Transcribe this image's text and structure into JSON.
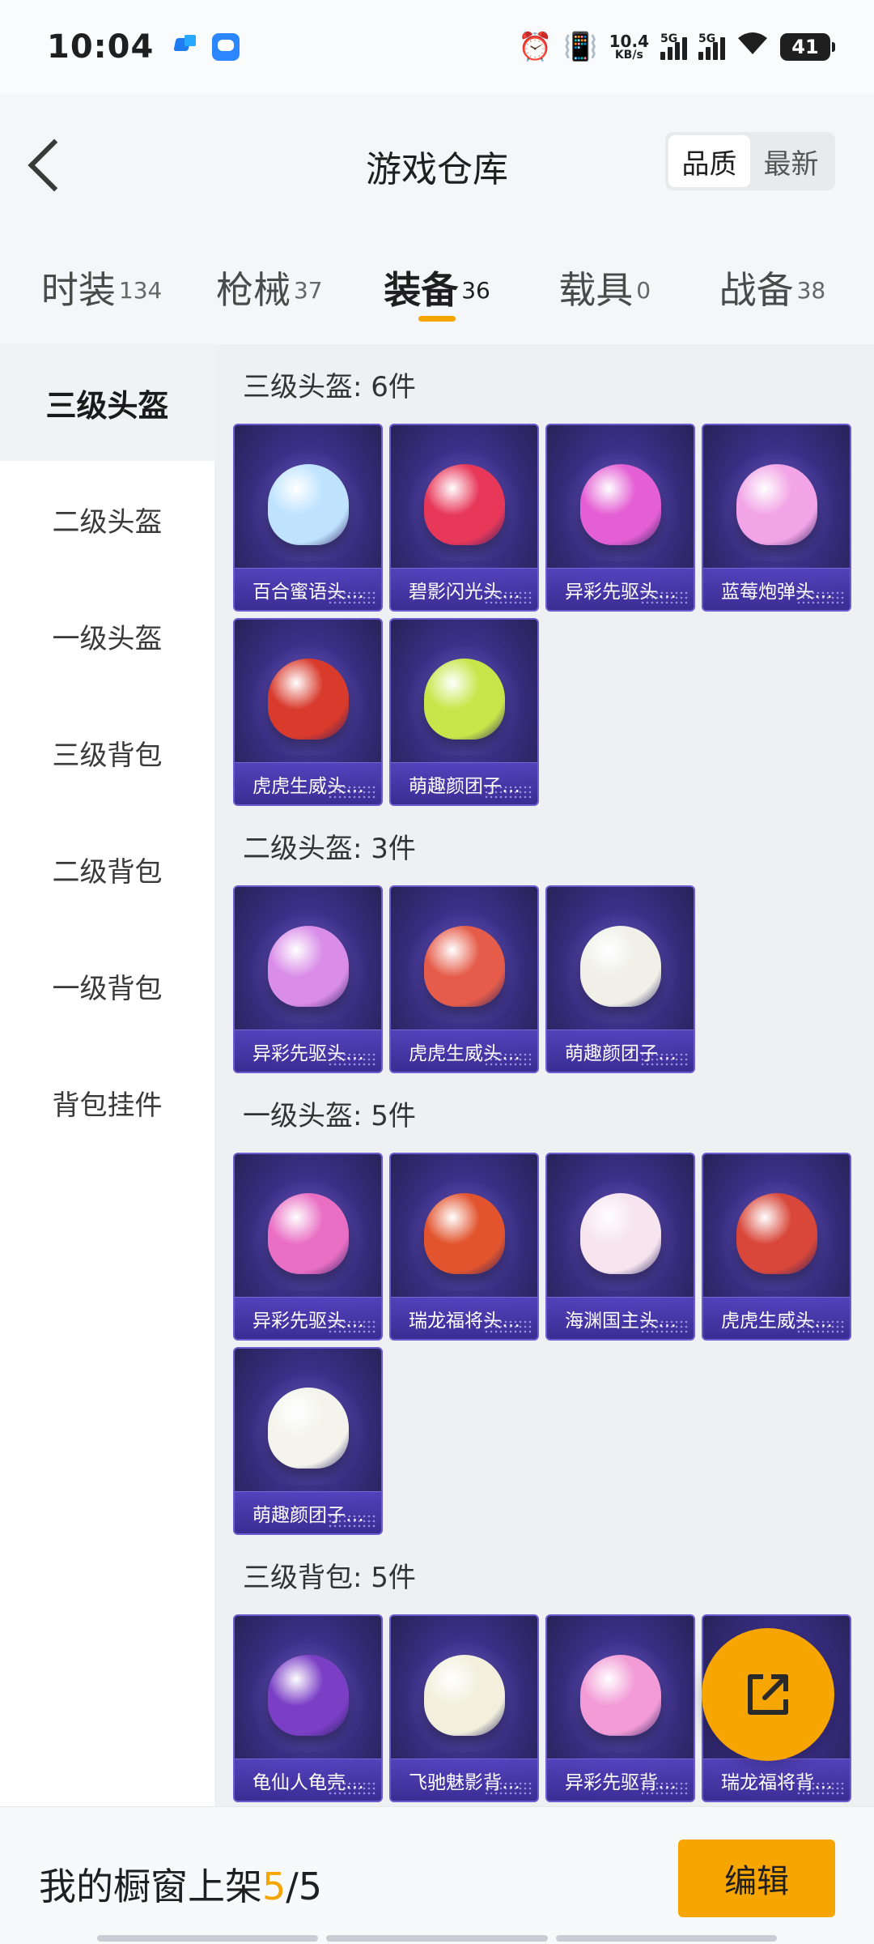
{
  "status_bar": {
    "time": "10:04",
    "net_speed_value": "10.4",
    "net_speed_unit": "KB/s",
    "sim1": "5G",
    "sim2": "5G",
    "battery": "41"
  },
  "header": {
    "title": "游戏仓库",
    "sort_options": [
      "品质",
      "最新"
    ],
    "active_sort": "品质"
  },
  "tabs": [
    {
      "label": "时装",
      "count": "134"
    },
    {
      "label": "枪械",
      "count": "37"
    },
    {
      "label": "装备",
      "count": "36",
      "active": true
    },
    {
      "label": "载具",
      "count": "0"
    },
    {
      "label": "战备",
      "count": "38"
    }
  ],
  "side_menu": [
    "三级头盔",
    "二级头盔",
    "一级头盔",
    "三级背包",
    "二级背包",
    "一级背包",
    "背包挂件"
  ],
  "sections": [
    {
      "title": "三级头盔: 6件",
      "items": [
        {
          "name": "百合蜜语头…",
          "color": "#bfe3ff"
        },
        {
          "name": "碧影闪光头…",
          "color": "#e8385a"
        },
        {
          "name": "异彩先驱头…",
          "color": "#e45fd4"
        },
        {
          "name": "蓝莓炮弹头…",
          "color": "#f2a4e6"
        },
        {
          "name": "虎虎生威头…",
          "color": "#d83a2c"
        },
        {
          "name": "萌趣颜团子…",
          "color": "#c8e64a"
        }
      ]
    },
    {
      "title": "二级头盔: 3件",
      "items": [
        {
          "name": "异彩先驱头…",
          "color": "#d98ce8"
        },
        {
          "name": "虎虎生威头…",
          "color": "#e55d4a"
        },
        {
          "name": "萌趣颜团子…",
          "color": "#f0f0e8"
        }
      ]
    },
    {
      "title": "一级头盔: 5件",
      "items": [
        {
          "name": "异彩先驱头…",
          "color": "#e96fc4"
        },
        {
          "name": "瑞龙福将头…",
          "color": "#e2542e"
        },
        {
          "name": "海渊国主头…",
          "color": "#f6e4ee"
        },
        {
          "name": "虎虎生威头…",
          "color": "#d8473a"
        },
        {
          "name": "萌趣颜团子…",
          "color": "#f4f4ec"
        }
      ]
    },
    {
      "title": "三级背包: 5件",
      "items": [
        {
          "name": "龟仙人龟壳…",
          "color": "#7b3fc6"
        },
        {
          "name": "飞驰魅影背…",
          "color": "#f2f0dc"
        },
        {
          "name": "异彩先驱背…",
          "color": "#f29bd6"
        },
        {
          "name": "瑞龙福将背…",
          "color": "#e2542e"
        }
      ]
    }
  ],
  "bottom_bar": {
    "label": "我的橱窗上架",
    "current": "5",
    "separator": "/",
    "max": "5",
    "edit_button": "编辑"
  },
  "colors": {
    "accent": "#f7a500",
    "card_bg": "#3a2f86"
  }
}
